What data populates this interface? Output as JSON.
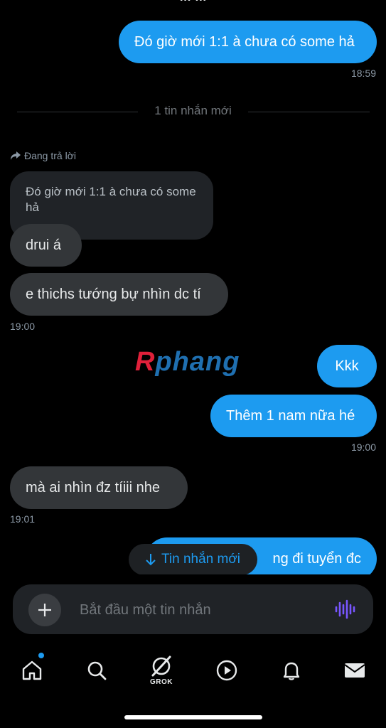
{
  "header": {
    "title_clipped": "… …"
  },
  "messages": [
    {
      "id": "m1",
      "dir": "out",
      "text": "Đó giờ mới 1:1 à chưa có some hả",
      "time": "18:59"
    },
    {
      "id": "m2",
      "dir": "in",
      "text": "drui á"
    },
    {
      "id": "m3",
      "dir": "in",
      "text": "e thichs tướng bự nhìn dc tí",
      "time": "19:00"
    },
    {
      "id": "m4",
      "dir": "out",
      "text": "Kkk"
    },
    {
      "id": "m5",
      "dir": "out",
      "text": "Thêm 1 nam nữa hé",
      "time": "19:00"
    },
    {
      "id": "m6",
      "dir": "in",
      "text": "mà ai nhìn đz tíiii nhe",
      "time": "19:01"
    },
    {
      "id": "m7",
      "dir": "out",
      "text": "ng đi tuyển đc"
    }
  ],
  "divider": {
    "text": "1 tin nhắn mới"
  },
  "reply": {
    "label": "Đang trả lời",
    "quoted_text": "Đó giờ mới 1:1 à chưa có some hả"
  },
  "watermark": {
    "first": "R",
    "rest": "phang"
  },
  "new_messages_button": {
    "label": "Tin nhắn mới",
    "icon": "arrow-down-icon"
  },
  "composer": {
    "placeholder": "Bắt đầu một tin nhắn",
    "value": "",
    "add_icon": "plus-icon",
    "voice_icon": "voice-waveform-icon"
  },
  "tabbar": {
    "items": [
      {
        "id": "home",
        "icon": "home-icon",
        "has_badge": true
      },
      {
        "id": "search",
        "icon": "search-icon"
      },
      {
        "id": "grok",
        "icon": "grok-icon",
        "label": "GROK"
      },
      {
        "id": "video",
        "icon": "play-icon"
      },
      {
        "id": "notifications",
        "icon": "bell-icon"
      },
      {
        "id": "messages",
        "icon": "envelope-icon",
        "active": true
      }
    ]
  },
  "colors": {
    "accent": "#1d9bf0",
    "incoming_bubble": "#333639",
    "background": "#000000",
    "voice_icon": "#7856ff",
    "watermark_red": "#e0203a",
    "watermark_blue": "#1f6fb0"
  }
}
